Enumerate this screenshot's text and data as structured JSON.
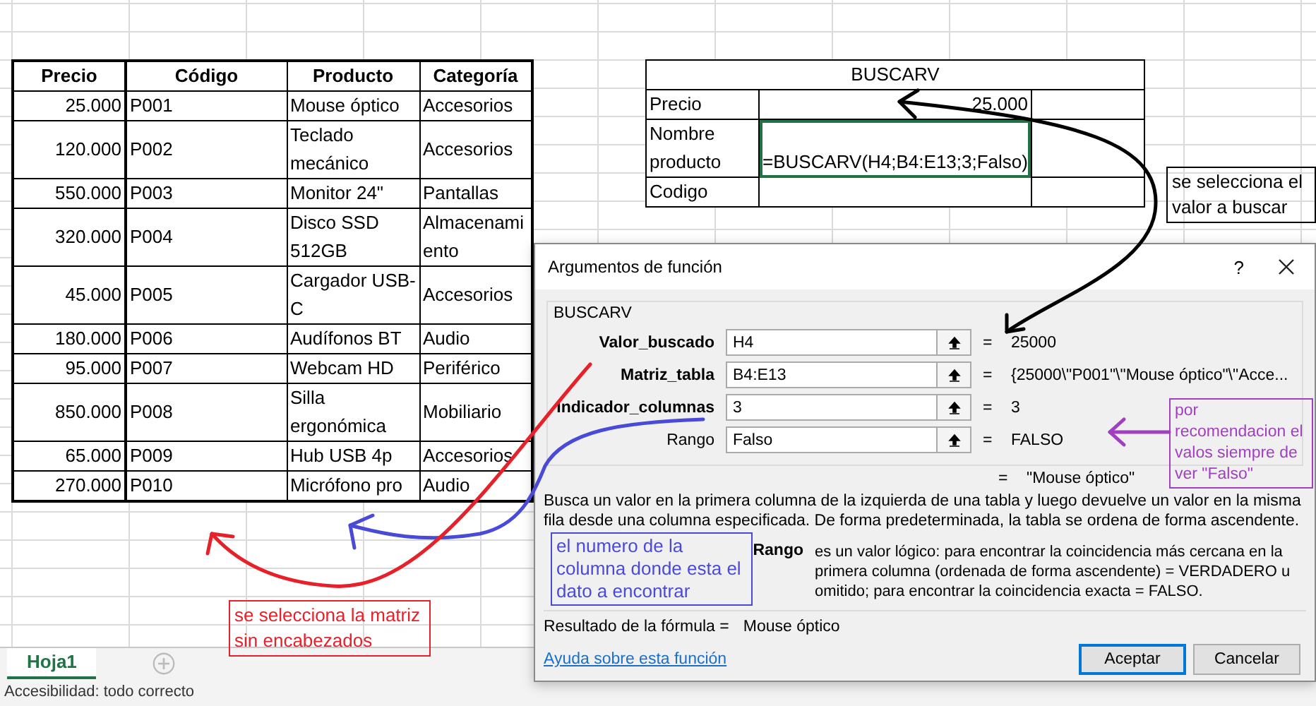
{
  "price_table": {
    "columns": [
      "Precio",
      "Código",
      "Producto",
      "Categoría"
    ],
    "rows": [
      {
        "precio": "25.000",
        "codigo": "P001",
        "producto": "Mouse óptico",
        "categoria": "Accesorios"
      },
      {
        "precio": "120.000",
        "codigo": "P002",
        "producto": "Teclado mecánico",
        "categoria": "Accesorios"
      },
      {
        "precio": "550.000",
        "codigo": "P003",
        "producto": "Monitor 24\"",
        "categoria": "Pantallas"
      },
      {
        "precio": "320.000",
        "codigo": "P004",
        "producto": "Disco SSD 512GB",
        "categoria": "Almacenamiento"
      },
      {
        "precio": "45.000",
        "codigo": "P005",
        "producto": "Cargador USB-C",
        "categoria": "Accesorios"
      },
      {
        "precio": "180.000",
        "codigo": "P006",
        "producto": "Audífonos BT",
        "categoria": "Audio"
      },
      {
        "precio": "95.000",
        "codigo": "P007",
        "producto": "Webcam HD",
        "categoria": "Periférico"
      },
      {
        "precio": "850.000",
        "codigo": "P008",
        "producto": "Silla ergonómica",
        "categoria": "Mobiliario"
      },
      {
        "precio": "65.000",
        "codigo": "P009",
        "producto": "Hub USB 4p",
        "categoria": "Accesorios"
      },
      {
        "precio": "270.000",
        "codigo": "P010",
        "producto": "Micrófono pro",
        "categoria": "Audio"
      }
    ]
  },
  "lookup_table": {
    "title": "BUSCARV",
    "rows": [
      {
        "label": "Precio",
        "value": "25.000",
        "selected": false
      },
      {
        "label": "Nombre producto",
        "value": "=BUSCARV(H4;B4:E13;3;Falso)",
        "selected": true
      },
      {
        "label": "Codigo",
        "selected": false
      }
    ]
  },
  "dialog": {
    "title": "Argumentos de función",
    "help_button": "?",
    "function_name": "BUSCARV",
    "arguments": [
      {
        "label": "Valor_buscado",
        "value": "H4",
        "equals": "=",
        "result": "25000",
        "required": true
      },
      {
        "label": "Matriz_tabla",
        "value": "B4:E13",
        "equals": "=",
        "result": "{25000\\\"P001\"\\\"Mouse óptico\"\\\"Acce...",
        "required": true
      },
      {
        "label": "Indicador_columnas",
        "value": "3",
        "equals": "=",
        "result": "3",
        "required": true
      },
      {
        "label": "Rango",
        "value": "Falso",
        "equals": "=",
        "result": "FALSO",
        "required": false
      }
    ],
    "function_equals": "=",
    "function_result": "\"Mouse óptico\"",
    "description": "Busca un valor en la primera columna de la izquierda de una tabla y luego devuelve un valor en la misma fila desde una columna especificada. De forma predeterminada, la tabla se ordena de forma ascendente.",
    "argument_help": {
      "label": "Rango",
      "text": "es un valor lógico: para encontrar la coincidencia más cercana en la primera columna (ordenada de forma ascendente) = VERDADERO u omitido; para encontrar la coincidencia exacta = FALSO."
    },
    "formula_result_label": "Resultado de la fórmula =",
    "formula_result": "Mouse óptico",
    "help_link": "Ayuda sobre esta función",
    "buttons": [
      {
        "label": "Aceptar",
        "default": true
      },
      {
        "label": "Cancelar",
        "default": false
      }
    ]
  },
  "annotations": [
    {
      "text": "se selecciona el valor a buscar",
      "color": "#000000"
    },
    {
      "text": "por recomendacion el valos siempre de ver \"Falso\"",
      "color": "#a040c0"
    },
    {
      "text": "el numero de la columna donde esta el dato a encontrar",
      "color": "#4a4ad8"
    },
    {
      "text": "se selecciona la matriz sin encabezados",
      "color": "#e8202a"
    }
  ],
  "sheet_tabs": [
    {
      "label": "Hoja1",
      "selected": true
    }
  ],
  "status_bar": "Accesibilidad: todo correcto"
}
